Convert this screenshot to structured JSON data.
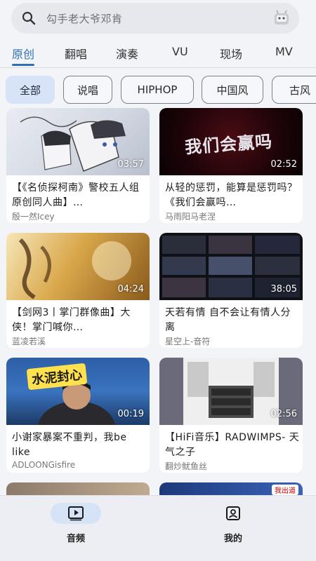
{
  "search": {
    "placeholder": "勾手老大爷邓肯"
  },
  "tabs": [
    "原创",
    "翻唱",
    "演奏",
    "VU",
    "现场",
    "MV"
  ],
  "active_tab": "原创",
  "chips": [
    "全部",
    "说唱",
    "HIPHOP",
    "中国风",
    "古风"
  ],
  "active_chip": "全部",
  "videos": [
    {
      "title": "【《名侦探柯南》警校五人组原创同人曲】…",
      "author": "殷一然Icey",
      "duration": "03:57",
      "thumb_text": ""
    },
    {
      "title": "从轻的惩罚，能算是惩罚吗？《我们会赢吗…",
      "author": "马雨阳马老涅",
      "duration": "02:52",
      "thumb_text": "我们会赢吗"
    },
    {
      "title": "【剑网3丨掌门群像曲】大侠！掌门喊你…",
      "author": "蓝凌若溪",
      "duration": "04:24",
      "thumb_text": ""
    },
    {
      "title": "天若有情 自不会让有情人分离",
      "author": "星空上-音符",
      "duration": "38:05",
      "thumb_text": ""
    },
    {
      "title": "小谢家暴案不重判，我be like",
      "author": "ADLOONGisfire",
      "duration": "00:19",
      "thumb_text": "水泥封心"
    },
    {
      "title": "【HiFi音乐】RADWIMPS- 天气之子",
      "author": "翻炒鱿鱼丝",
      "duration": "02:56",
      "thumb_text": ""
    }
  ],
  "partial_badge": "我出道",
  "bottom_nav": [
    {
      "label": "音频",
      "icon": "play-video-icon"
    },
    {
      "label": "我的",
      "icon": "profile-icon"
    }
  ],
  "colors": {
    "accent": "#2f6fb5",
    "chip_active": "#d7e3f6",
    "background": "#f3f4f8"
  }
}
